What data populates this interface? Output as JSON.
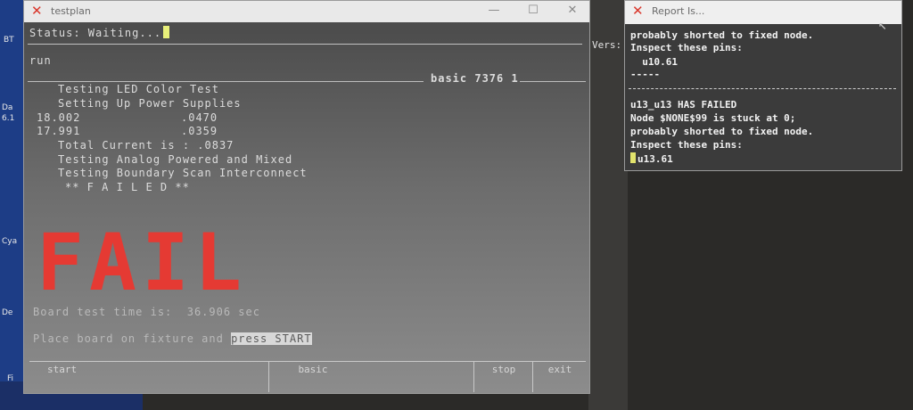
{
  "desktop": {
    "labels": [
      "BT",
      "Da",
      "6.1",
      "Cya",
      "De",
      "Fi"
    ]
  },
  "testplan": {
    "title": "testplan",
    "status_line": "Status: Waiting...",
    "command": "run",
    "header_right": "basic 7376 1",
    "log_lines": [
      "Testing LED Color Test",
      "Setting Up Power Supplies"
    ],
    "readings": [
      {
        "voltage": "18.002",
        "current": ".0470"
      },
      {
        "voltage": "17.991",
        "current": ".0359"
      }
    ],
    "total_current": "Total Current is : .0837",
    "more_lines": [
      "Testing Analog Powered and Mixed",
      "Testing Boundary Scan Interconnect"
    ],
    "failed_banner": "** F A I L E D **",
    "fail_big": "FAIL",
    "board_time": "Board test time is:  36.906 sec",
    "place_prompt": "Place board on fixture and",
    "place_prompt_hl": "press START",
    "softkeys": [
      "start",
      "basic",
      "stop",
      "exit"
    ],
    "controls": {
      "minimize": "—",
      "maximize": "☐",
      "close": "✕"
    }
  },
  "report": {
    "title": "Report Is...",
    "lines_top": [
      "probably shorted to fixed node.",
      "Inspect these pins:",
      "  u10.61",
      "-----"
    ],
    "lines_bottom": [
      "u13_u13 HAS FAILED",
      "Node $NONE$99 is stuck at 0;",
      "probably shorted to fixed node.",
      "Inspect these pins:"
    ],
    "pin": "u13.61"
  },
  "vers_label": "Vers:"
}
